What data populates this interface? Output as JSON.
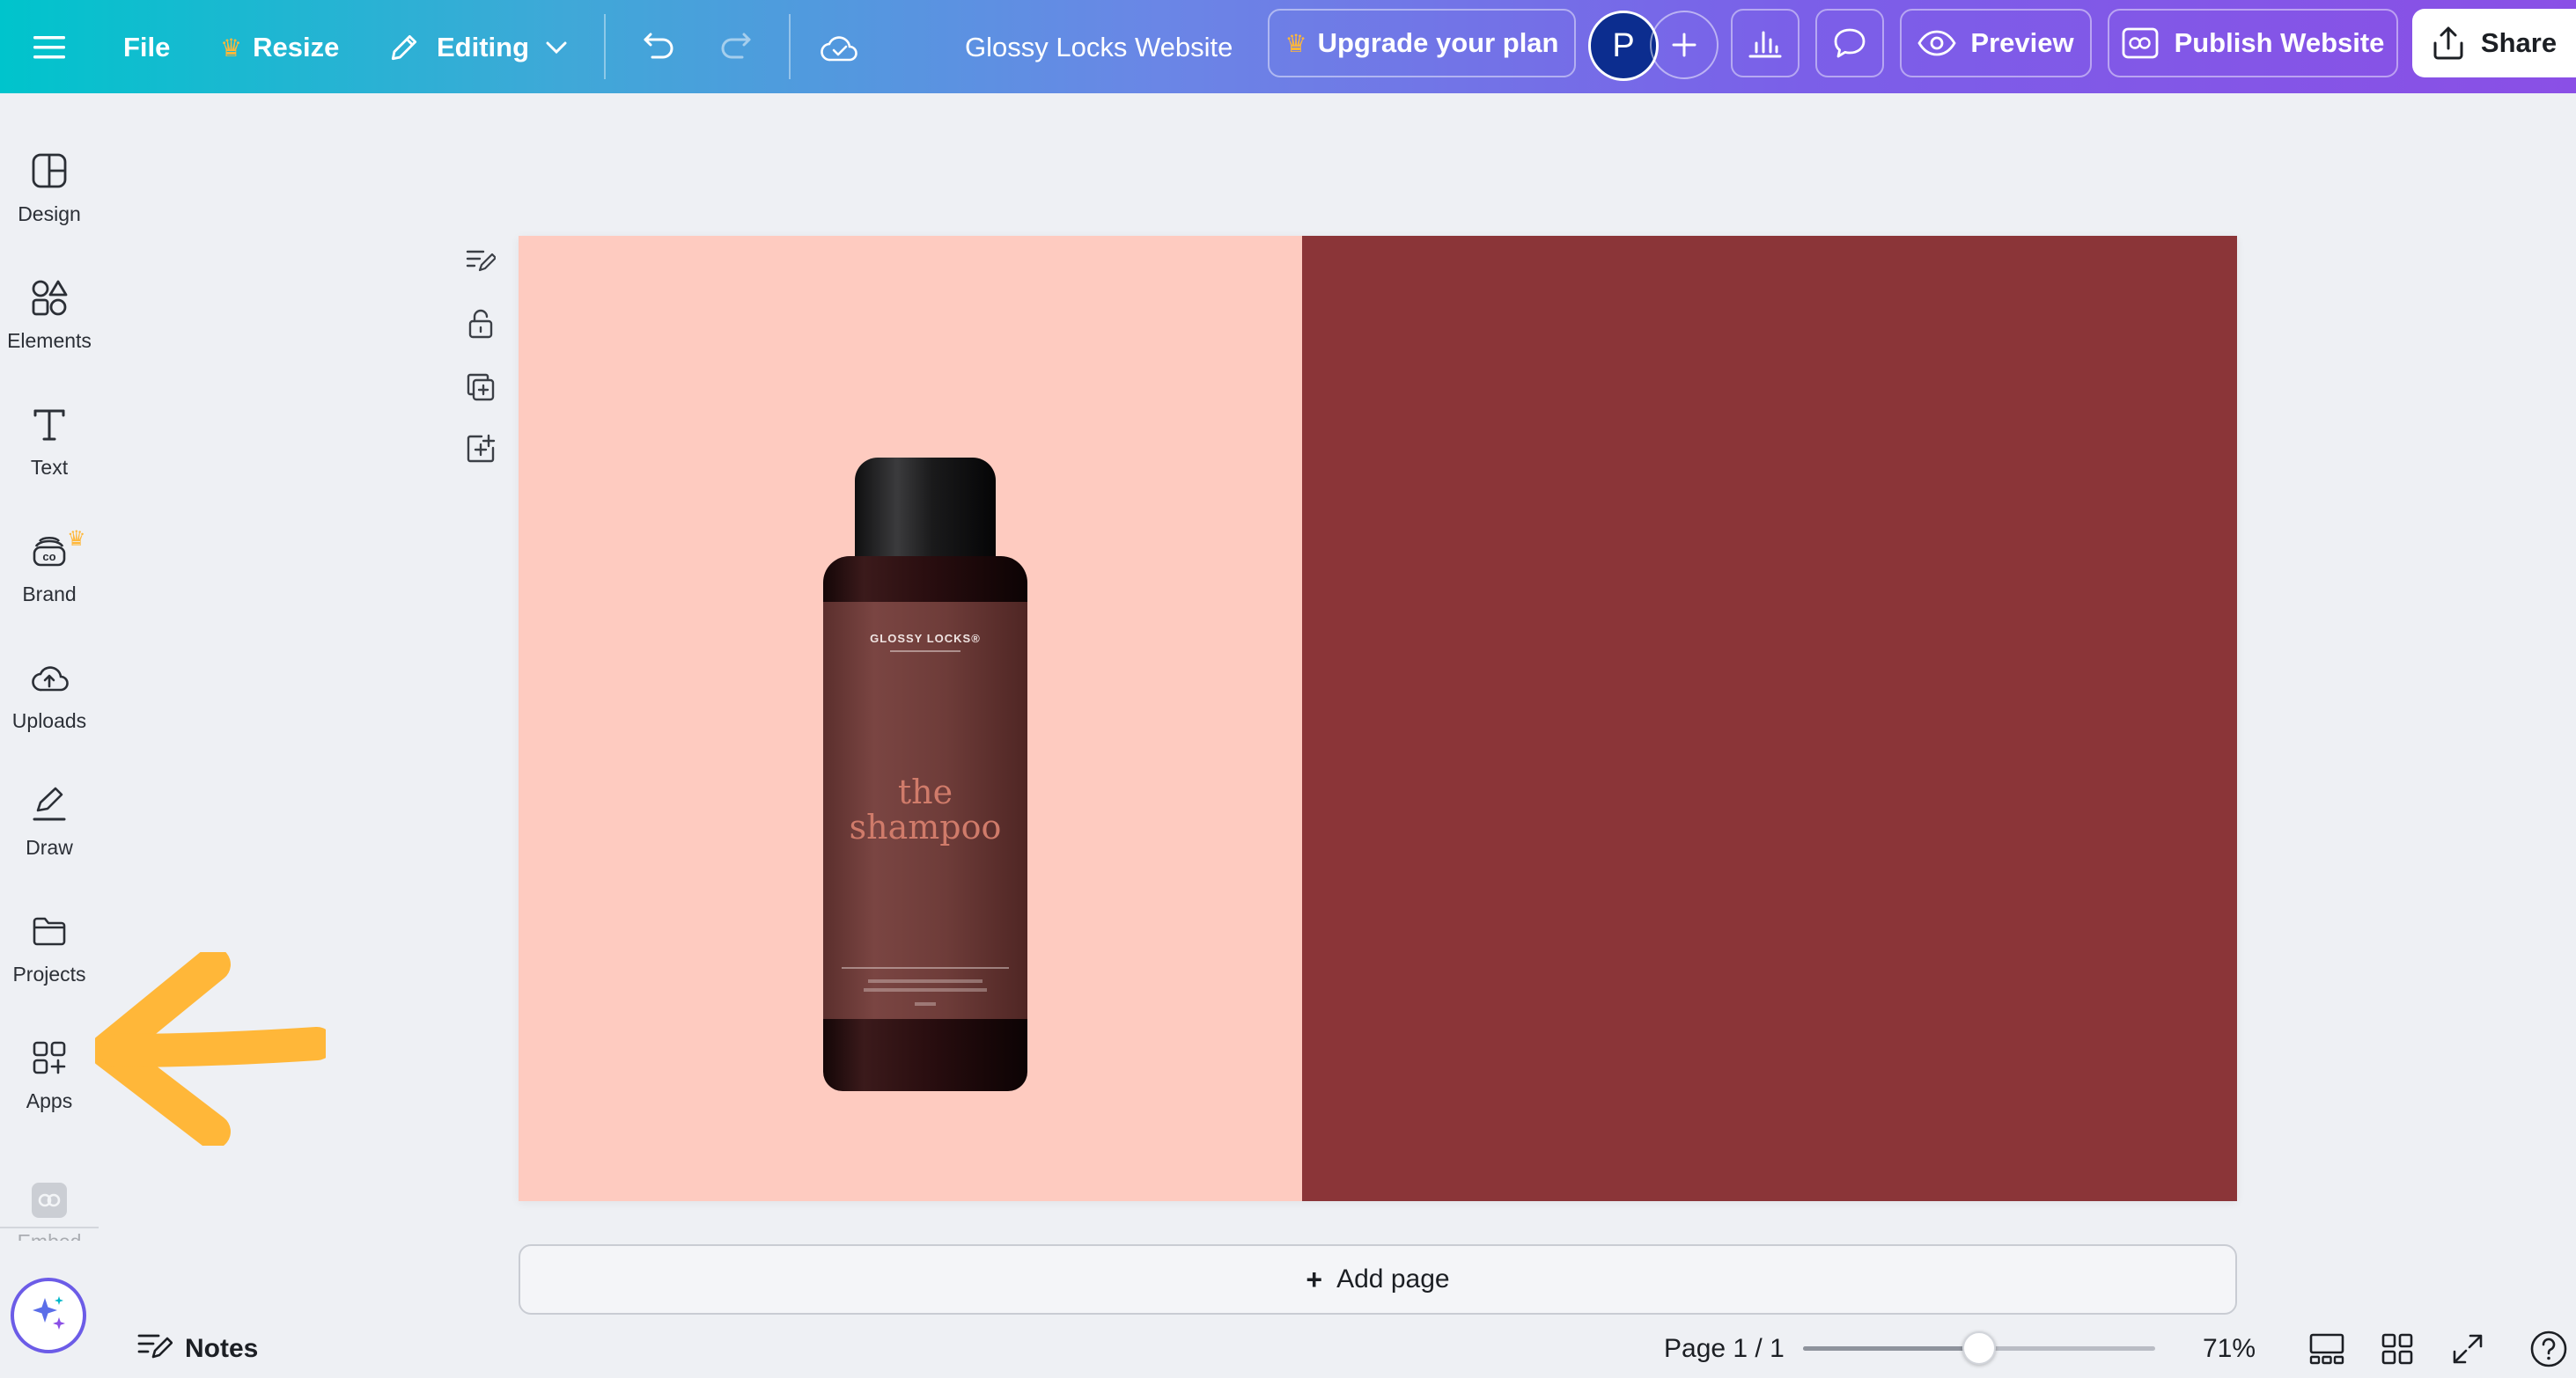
{
  "toolbar": {
    "file_label": "File",
    "resize_label": "Resize",
    "editing_label": "Editing",
    "doc_title": "Glossy Locks Website",
    "upgrade_label": "Upgrade your plan",
    "avatar_letter": "P",
    "preview_label": "Preview",
    "publish_label": "Publish Website",
    "share_label": "Share"
  },
  "sidebar": {
    "items": [
      {
        "label": "Design",
        "icon": "design-icon"
      },
      {
        "label": "Elements",
        "icon": "elements-icon"
      },
      {
        "label": "Text",
        "icon": "text-icon"
      },
      {
        "label": "Brand",
        "icon": "brand-icon"
      },
      {
        "label": "Uploads",
        "icon": "uploads-icon"
      },
      {
        "label": "Draw",
        "icon": "draw-icon"
      },
      {
        "label": "Projects",
        "icon": "projects-icon"
      },
      {
        "label": "Apps",
        "icon": "apps-icon"
      },
      {
        "label": "Embed",
        "icon": "embed-icon"
      }
    ]
  },
  "canvas": {
    "bottle_brand": "GLOSSY LOCKS®",
    "bottle_line1": "the",
    "bottle_line2": "shampoo",
    "left_color": "#fecbc0",
    "right_color": "#8b3538"
  },
  "footer": {
    "add_page_label": "Add page",
    "notes_label": "Notes",
    "page_indicator": "Page 1 / 1",
    "zoom_label": "71%",
    "zoom_fraction": 0.5
  },
  "annotation": {
    "arrow_color": "#ffb739"
  }
}
